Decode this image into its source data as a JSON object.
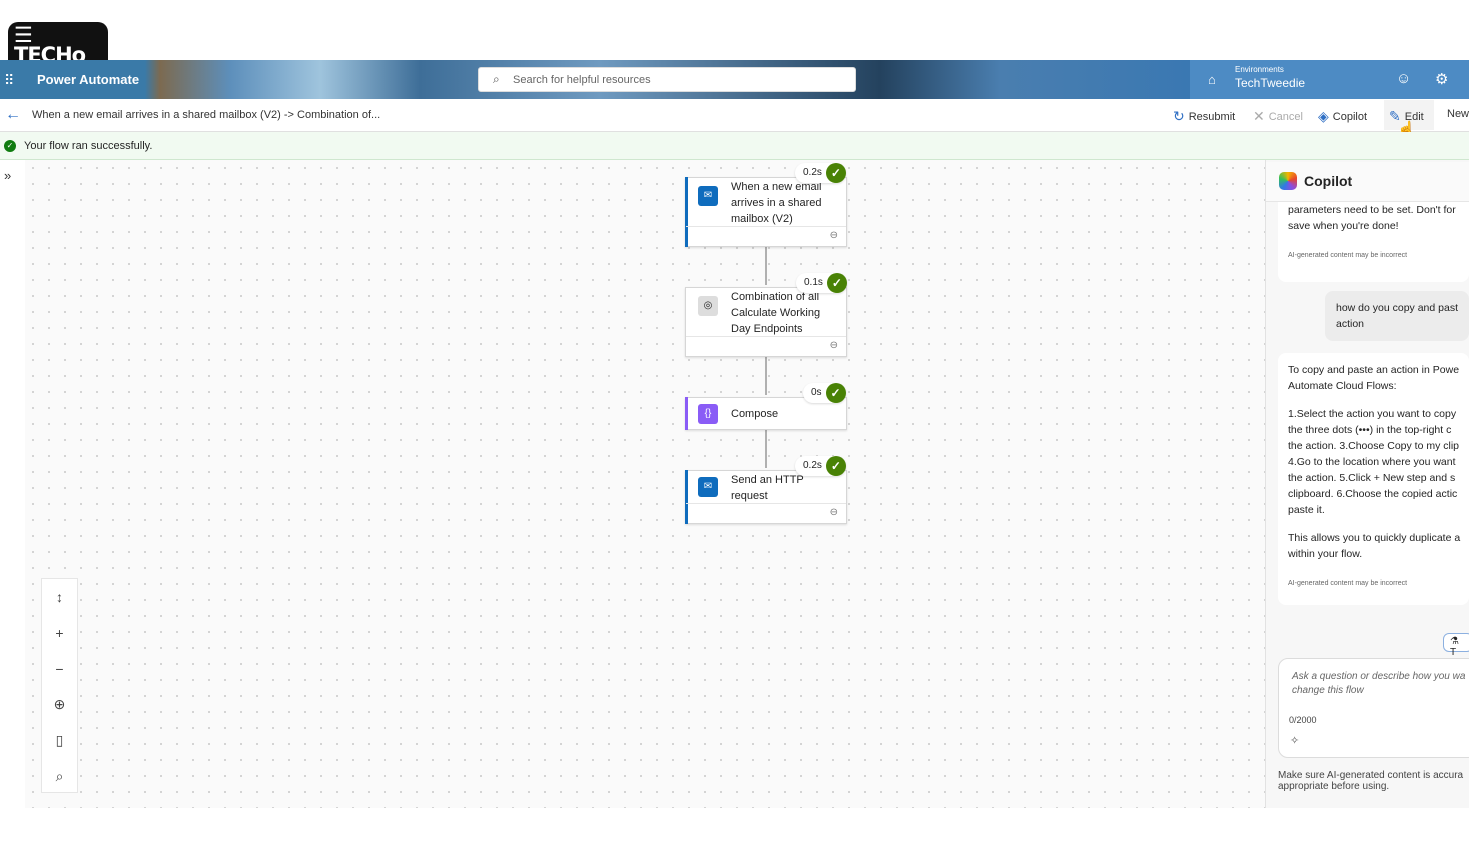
{
  "logo": {
    "text": "TECHO TWEEDIE"
  },
  "header": {
    "app_name": "Power Automate",
    "search_placeholder": "Search for helpful resources",
    "environment_label": "Environments",
    "environment_value": "TechTweedie"
  },
  "commandbar": {
    "breadcrumb": "When a new email arrives in a shared mailbox (V2) -> Combination of...",
    "resubmit": "Resubmit",
    "cancel": "Cancel",
    "copilot": "Copilot",
    "edit": "Edit",
    "new": "New"
  },
  "status": {
    "message": "Your flow ran successfully."
  },
  "flow": {
    "steps": [
      {
        "title_lines": [
          "When a new email",
          "arrives in a shared",
          "mailbox (V2)"
        ],
        "duration": "0.2s",
        "icon": "outlook-icon",
        "color": "#0f6cbd"
      },
      {
        "title_lines": [
          "Combination of all",
          "Calculate Working",
          "Day Endpoints"
        ],
        "duration": "0.1s",
        "icon": "child-flow-icon",
        "color": "#d0d0d0"
      },
      {
        "title_lines": [
          "Compose"
        ],
        "duration": "0s",
        "icon": "compose-icon",
        "color": "#8a5cf6"
      },
      {
        "title_lines": [
          "Send an HTTP",
          "request"
        ],
        "duration": "0.2s",
        "icon": "outlook-icon",
        "color": "#0f6cbd"
      }
    ]
  },
  "copilot": {
    "title": "Copilot",
    "msg1_lines": [
      "parameters need to be set. Don't for",
      "save when you're done!"
    ],
    "disclaimer": "AI-generated content may be incorrect",
    "user_lines": [
      "how do you copy and past",
      "action"
    ],
    "answer_intro": [
      "To copy and paste an action in Powe",
      "Automate Cloud Flows:"
    ],
    "answer_steps": [
      "1.Select the action you want to copy",
      "the three dots (•••) in the top-right c",
      "the action. 3.Choose Copy to my clip",
      "4.Go to the location where you want",
      "the action. 5.Click + New step and s",
      "clipboard. 6.Choose the copied actic",
      "paste it."
    ],
    "answer_outro": [
      "This allows you to quickly duplicate a",
      "within your flow."
    ],
    "chip": "T",
    "input_placeholder_lines": [
      "Ask a question or describe how you wa",
      "change this flow"
    ],
    "char_count": "0/2000",
    "footer_lines": [
      "Make sure AI-generated content is accura",
      "appropriate before using."
    ]
  }
}
